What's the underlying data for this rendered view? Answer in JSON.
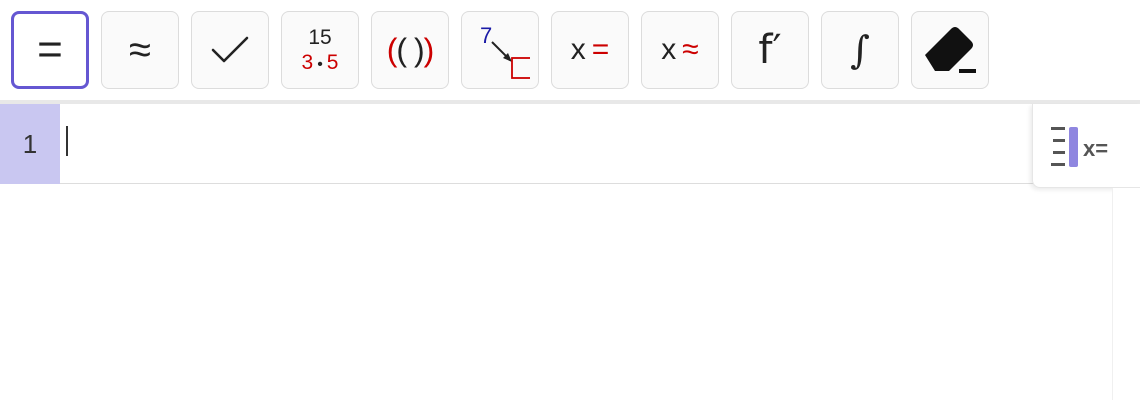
{
  "toolbar": {
    "tools": [
      {
        "name": "evaluate",
        "label": "=",
        "active": true
      },
      {
        "name": "numeric",
        "label": "≈",
        "active": false
      },
      {
        "name": "keep-input",
        "label": "✓",
        "active": false
      },
      {
        "name": "factor",
        "top": "15",
        "bottom_left": "3",
        "bottom_dot": "•",
        "bottom_right": "5",
        "active": false
      },
      {
        "name": "expand",
        "label_red_open": "(",
        "label_black": "( )",
        "label_red_close": ")",
        "active": false
      },
      {
        "name": "substitute",
        "top": "7",
        "active": false
      },
      {
        "name": "solve",
        "x": "x",
        "op": "=",
        "active": false
      },
      {
        "name": "solve-numerically",
        "x": "x",
        "op": "≈",
        "active": false
      },
      {
        "name": "derivative",
        "label": "f′",
        "active": false
      },
      {
        "name": "integral",
        "label": "∫",
        "active": false
      },
      {
        "name": "delete",
        "label": "",
        "active": false
      }
    ]
  },
  "workspace": {
    "rows": [
      {
        "number": "1",
        "value": ""
      }
    ],
    "side_toggle_label": "x="
  },
  "colors": {
    "accent": "#6557d2",
    "row_highlight": "#c9c7f1",
    "red": "#cc0000",
    "border": "#dcdcdc"
  }
}
